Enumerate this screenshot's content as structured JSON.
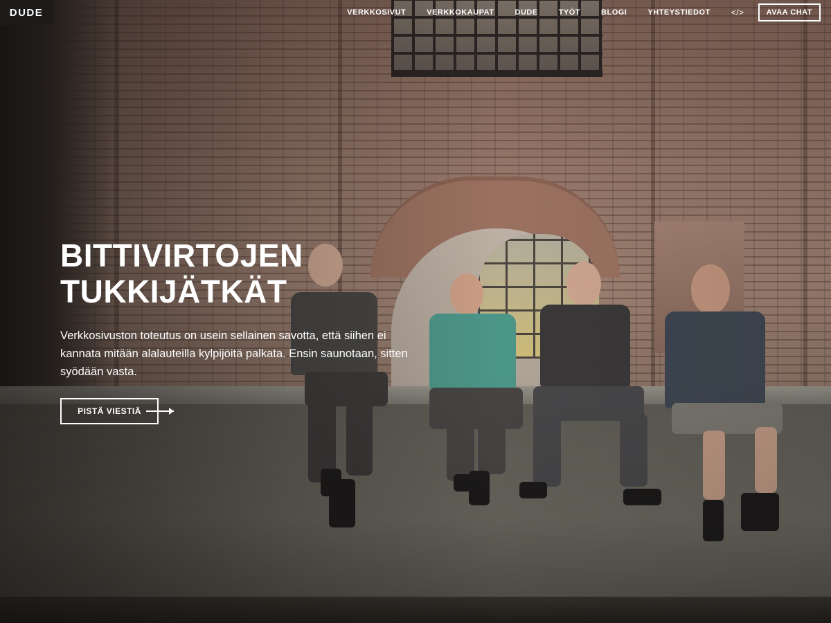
{
  "brand": {
    "logo_text": "DUDE"
  },
  "nav": {
    "items": [
      {
        "label": "VERKKOSIVUT"
      },
      {
        "label": "VERKKOKAUPAT"
      },
      {
        "label": "DUDE"
      },
      {
        "label": "TYÖT"
      },
      {
        "label": "BLOGI"
      },
      {
        "label": "YHTEYSTIEDOT"
      }
    ],
    "code_label": "</>",
    "chat_label": "AVAA CHAT"
  },
  "hero": {
    "headline_line1": "BITTIVIRTOJEN",
    "headline_line2": "TUKKIJÄTKÄT",
    "lead": "Verkkosivuston toteutus on usein sellainen savotta, että siihen ei kannata mitään alalauteilla kylpijöitä palkata. Ensin saunotaan, sitten syödään vasta.",
    "cta_label": "PISTÄ VIESTIÄ",
    "cta_icon": "arrow-right-icon"
  },
  "colors": {
    "text": "#ffffff",
    "logo_bg": "#1d1b1a"
  }
}
